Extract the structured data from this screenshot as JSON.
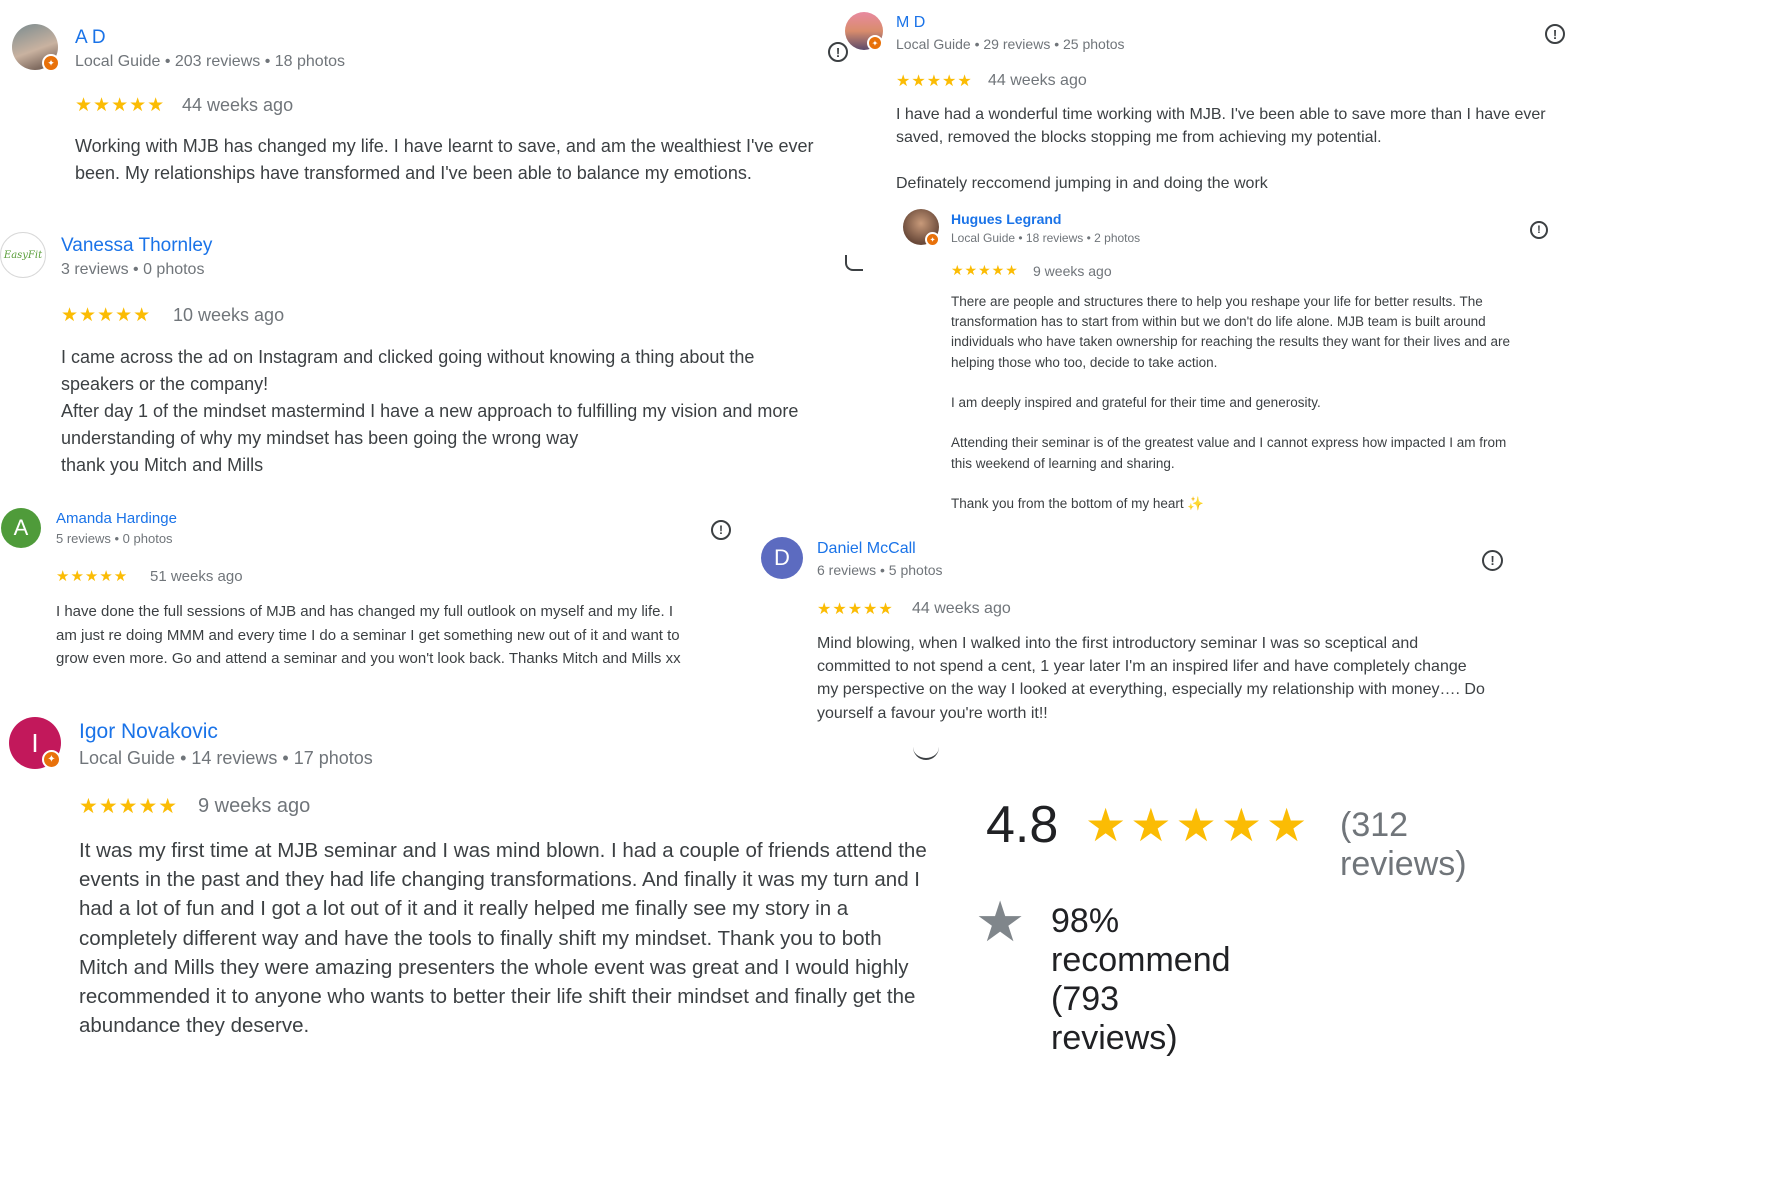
{
  "reviews": {
    "ad": {
      "initial": "",
      "name": "A D",
      "meta": "Local Guide • 203 reviews • 18 photos",
      "stars": "★★★★★",
      "when": "44 weeks ago",
      "text": "Working with MJB has changed my life. I have learnt to save, and am the wealthiest I've ever\nbeen. My relationships have transformed and I've been able to balance my emotions."
    },
    "md": {
      "name": "M D",
      "meta": "Local Guide • 29 reviews • 25 photos",
      "stars": "★★★★★",
      "when": "44 weeks ago",
      "text": "I have had a wonderful time working with MJB. I've been able to save more than I have ever\nsaved, removed the blocks stopping me from achieving my potential.\n\nDefinately reccomend jumping in and doing the work"
    },
    "vanessa": {
      "logo_text": "EasyFit",
      "name": "Vanessa Thornley",
      "meta": "3 reviews • 0 photos",
      "stars": "★★★★★",
      "when": "10 weeks ago",
      "text": "I came across the ad on Instagram and clicked going without knowing a thing about the\nspeakers or the company!\nAfter day 1 of the mindset mastermind I have a new approach to fulfilling my vision and more\nunderstanding of why my mindset has been going the wrong way\nthank you Mitch and Mills"
    },
    "hugues": {
      "name": "Hugues Legrand",
      "meta": "Local Guide • 18 reviews • 2 photos",
      "stars": "★★★★★",
      "when": "9 weeks ago",
      "text": "There are people and structures there to help you reshape your life for better results. The\ntransformation has to start from within but we don't do life alone. MJB team is built around\nindividuals who have taken ownership for reaching the results they want for their lives and are\nhelping those who too, decide to take action.\n\nI am deeply inspired and grateful for their time and generosity.\n\nAttending their seminar is of the greatest value and I cannot express how impacted I am from\nthis weekend of learning and sharing.\n\nThank you from the bottom of my heart ✨"
    },
    "amanda": {
      "initial": "A",
      "name": "Amanda Hardinge",
      "meta": "5 reviews • 0 photos",
      "stars": "★★★★★",
      "when": "51 weeks ago",
      "text": "I have done the full sessions of MJB and has changed my full outlook on myself and my life. I\nam just re doing MMM and every time I do a seminar I get something new out of it and want to\ngrow even more. Go and attend a seminar and you won't look back. Thanks Mitch and Mills xx"
    },
    "daniel": {
      "initial": "D",
      "name": "Daniel McCall",
      "meta": "6 reviews • 5 photos",
      "stars": "★★★★★",
      "when": "44 weeks ago",
      "text": "Mind blowing, when I walked into the first introductory seminar I was so sceptical and\ncommitted to not spend a cent, 1 year later I'm an inspired lifer and have completely change\nmy perspective on the way I looked at everything, especially my relationship with money…. Do\nyourself a favour you're worth it!!"
    },
    "igor": {
      "initial": "I",
      "name": "Igor Novakovic",
      "meta": "Local Guide • 14 reviews • 17 photos",
      "stars": "★★★★★",
      "when": "9 weeks ago",
      "text": "It was my first time at MJB seminar and I was mind blown. I had a couple of friends attend the\nevents in the past and they had life changing transformations. And finally it was my turn and I\nhad a lot of fun and I got a lot out of it and it really helped me finally see my story in a\ncompletely different way and have the tools to finally shift my mindset. Thank you to both\nMitch and Mills they were amazing presenters the whole event was great and I would highly\nrecommended it to anyone who wants to better their life shift their mindset and finally get the\nabundance they deserve."
    }
  },
  "summary": {
    "score": "4.8",
    "stars": "★★★★★",
    "count": "(312 reviews)",
    "recommend": "98% recommend (793 reviews)"
  },
  "icons": {
    "flag": "!",
    "badge": "✦",
    "star": "★"
  },
  "colors": {
    "link_blue": "#1a73e8",
    "star_yellow": "#fbbc04",
    "badge_orange": "#e8710a",
    "amanda_avatar": "#4f9b3a",
    "daniel_avatar": "#5c6bc0",
    "igor_avatar": "#c2185b"
  }
}
